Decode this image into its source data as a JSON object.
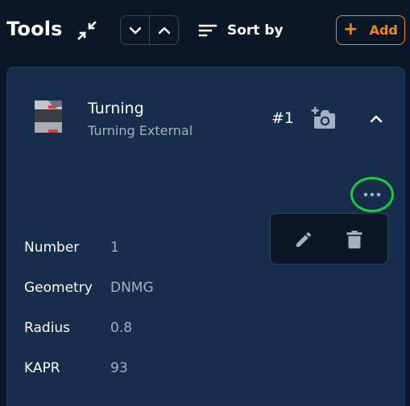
{
  "header": {
    "title": "Tools",
    "collapse_icon": "collapse-arrows-icon",
    "nav_down_icon": "chevron-down-icon",
    "nav_up_icon": "chevron-up-icon",
    "sort_icon": "sort-lines-icon",
    "sort_label": "Sort by",
    "add_icon": "plus-icon",
    "add_label": "Add"
  },
  "tool": {
    "icon": "turning-tool-icon",
    "name": "Turning",
    "type": "Turning External",
    "number_badge": "#1",
    "camera_icon": "add-photo-camera-icon",
    "expand_icon": "chevron-up-icon",
    "more_icon": "more-horizontal-icon",
    "actions": {
      "edit_icon": "pencil-icon",
      "delete_icon": "trash-icon"
    },
    "properties": [
      {
        "label": "Number",
        "value": "1"
      },
      {
        "label": "Geometry",
        "value": "DNMG"
      },
      {
        "label": "Radius",
        "value": "0.8"
      },
      {
        "label": "KAPR",
        "value": "93"
      }
    ]
  },
  "colors": {
    "background": "#0b1726",
    "card": "#162d4b",
    "accent": "#f08a1c",
    "highlight_ring": "#1fc93e",
    "muted_text": "#a3b1c2"
  }
}
